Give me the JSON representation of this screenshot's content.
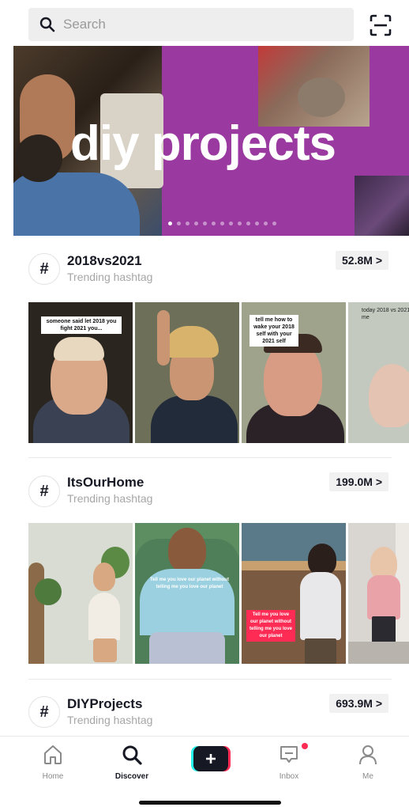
{
  "search": {
    "placeholder": "Search"
  },
  "banner": {
    "title": "diy projects",
    "dot_count": 13,
    "active_dot": 0,
    "accent": "#9a3aa0"
  },
  "hashtags": [
    {
      "name": "2018vs2021",
      "subtitle": "Trending hashtag",
      "count": "52.8M >",
      "captions": [
        "someone said let 2018 you fight 2021 you...",
        "",
        "tell me how to wake your 2018 self with your 2021 self",
        "today 2018 vs 2021 me"
      ]
    },
    {
      "name": "ItsOurHome",
      "subtitle": "Trending hashtag",
      "count": "199.0M >",
      "captions": [
        "",
        "Tell me you love our planet without telling me you love our planet",
        "Tell me you love our planet without telling me you love our planet",
        ""
      ]
    },
    {
      "name": "DIYProjects",
      "subtitle": "Trending hashtag",
      "count": "693.9M >"
    }
  ],
  "tabs": [
    {
      "label": "Home",
      "icon": "home-icon"
    },
    {
      "label": "Discover",
      "icon": "search-icon"
    },
    {
      "label": "",
      "icon": "plus-icon"
    },
    {
      "label": "Inbox",
      "icon": "inbox-icon"
    },
    {
      "label": "Me",
      "icon": "profile-icon"
    }
  ],
  "colors": {
    "notification_dot": "#fe2c55",
    "create_left": "#25f4ee",
    "create_right": "#fe2c55"
  }
}
